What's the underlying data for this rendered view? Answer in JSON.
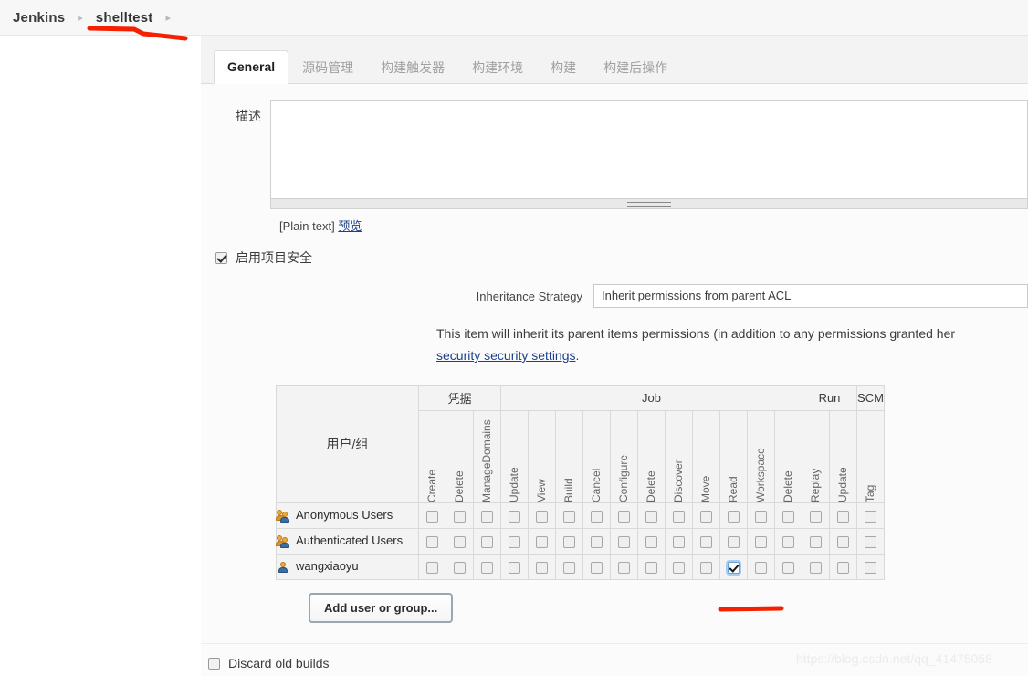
{
  "breadcrumb": {
    "items": [
      {
        "label": "Jenkins"
      },
      {
        "label": "shelltest"
      }
    ],
    "separator": "▸"
  },
  "tabs": [
    {
      "label": "General",
      "active": true
    },
    {
      "label": "源码管理",
      "active": false
    },
    {
      "label": "构建触发器",
      "active": false
    },
    {
      "label": "构建环境",
      "active": false
    },
    {
      "label": "构建",
      "active": false
    },
    {
      "label": "构建后操作",
      "active": false
    }
  ],
  "description": {
    "label": "描述",
    "value": "",
    "placeholder": "",
    "plain_text_note": "[Plain text]",
    "preview_link": "预览"
  },
  "project_security": {
    "label": "启用项目安全",
    "checked": true
  },
  "inheritance": {
    "label": "Inheritance Strategy",
    "selected": "Inherit permissions from parent ACL",
    "note_before": "This item will inherit its parent items permissions (in addition to any permissions granted her",
    "note_link": "security security settings",
    "note_after": "."
  },
  "matrix": {
    "corner_header": "用户/组",
    "groups": [
      {
        "label": "凭据",
        "span": 3
      },
      {
        "label": "Job",
        "span": 11
      },
      {
        "label": "Run",
        "span": 2
      },
      {
        "label": "SCM",
        "span": 1
      }
    ],
    "columns": [
      "Create",
      "Delete",
      "ManageDomains",
      "Update",
      "View",
      "Build",
      "Cancel",
      "Configure",
      "Delete",
      "Discover",
      "Move",
      "Read",
      "Workspace",
      "Delete",
      "Replay",
      "Update",
      "Tag"
    ],
    "rows": [
      {
        "name": "Anonymous Users",
        "icon": "users-group-icon",
        "checked": [
          false,
          false,
          false,
          false,
          false,
          false,
          false,
          false,
          false,
          false,
          false,
          false,
          false,
          false,
          false,
          false,
          false
        ]
      },
      {
        "name": "Authenticated Users",
        "icon": "users-group-icon",
        "checked": [
          false,
          false,
          false,
          false,
          false,
          false,
          false,
          false,
          false,
          false,
          false,
          false,
          false,
          false,
          false,
          false,
          false
        ]
      },
      {
        "name": "wangxiaoyu",
        "icon": "user-icon",
        "checked": [
          false,
          false,
          false,
          false,
          false,
          false,
          false,
          false,
          false,
          false,
          false,
          true,
          false,
          false,
          false,
          false,
          false
        ]
      }
    ],
    "row_actions": {
      "select_all": "select-all-icon",
      "deselect_all": "deselect-all-icon",
      "remove": "remove-row-icon"
    }
  },
  "add_user_button": "Add user or group...",
  "discard_old_builds": {
    "label": "Discard old builds",
    "checked": false
  },
  "watermark": "https://blog.csdn.net/qq_41475058",
  "colors": {
    "accent_link": "#1b3f8b",
    "annotation_red": "#f42000",
    "delete_red": "#e05b5b",
    "checkbox_focus_blue": "#6b9fd6"
  }
}
